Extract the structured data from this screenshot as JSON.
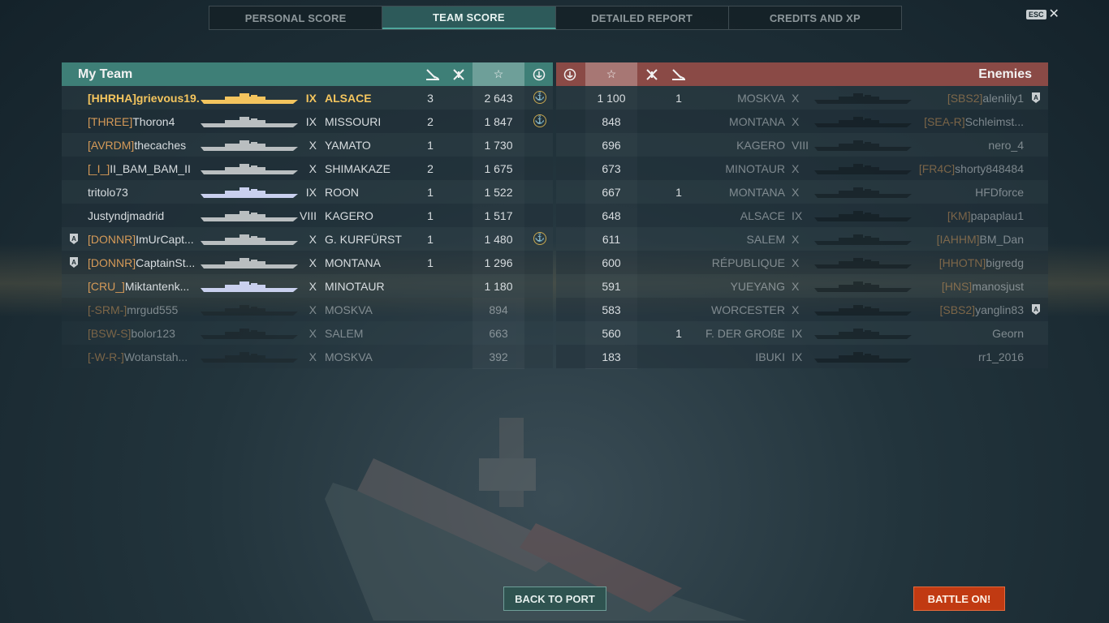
{
  "tabs": [
    {
      "label": "PERSONAL SCORE"
    },
    {
      "label": "TEAM SCORE"
    },
    {
      "label": "DETAILED REPORT"
    },
    {
      "label": "CREDITS AND XP"
    }
  ],
  "active_tab": "TEAM SCORE",
  "esc_label": "ESC",
  "close_glyph": "✕",
  "my_team": {
    "title": "My Team",
    "rows": [
      {
        "clan": "[HHRHA]",
        "name": "grievous19...",
        "tier": "IX",
        "ship": "ALSACE",
        "kills": "3",
        "xp": "2 643",
        "anchor": true,
        "badge": false
      },
      {
        "clan": "[THREE]",
        "name": "Thoron4",
        "tier": "IX",
        "ship": "MISSOURI",
        "kills": "2",
        "xp": "1 847",
        "anchor": true,
        "badge": false
      },
      {
        "clan": "[AVRDM]",
        "name": "thecaches",
        "tier": "X",
        "ship": "YAMATO",
        "kills": "1",
        "xp": "1 730",
        "anchor": false,
        "badge": false
      },
      {
        "clan": "[_I_]",
        "name": "II_BAM_BAM_II",
        "tier": "X",
        "ship": "SHIMAKAZE",
        "kills": "2",
        "xp": "1 675",
        "anchor": false,
        "badge": false
      },
      {
        "clan": "",
        "name": "tritolo73",
        "tier": "IX",
        "ship": "ROON",
        "kills": "1",
        "xp": "1 522",
        "anchor": false,
        "badge": false
      },
      {
        "clan": "",
        "name": "Justyndjmadrid",
        "tier": "VIII",
        "ship": "KAGERO",
        "kills": "1",
        "xp": "1 517",
        "anchor": false,
        "badge": false
      },
      {
        "clan": "[DONNR]",
        "name": "ImUrCapt...",
        "tier": "X",
        "ship": "G. KURFÜRST",
        "kills": "1",
        "xp": "1 480",
        "anchor": true,
        "badge": true
      },
      {
        "clan": "[DONNR]",
        "name": "CaptainSt...",
        "tier": "X",
        "ship": "MONTANA",
        "kills": "1",
        "xp": "1 296",
        "anchor": false,
        "badge": true
      },
      {
        "clan": "[CRU_]",
        "name": "Miktantenk...",
        "tier": "X",
        "ship": "MINOTAUR",
        "kills": "",
        "xp": "1 180",
        "anchor": false,
        "badge": false
      },
      {
        "clan": "[-SRM-]",
        "name": "mrgud555",
        "tier": "X",
        "ship": "MOSKVA",
        "kills": "",
        "xp": "894",
        "anchor": false,
        "badge": false
      },
      {
        "clan": "[BSW-S]",
        "name": "bolor123",
        "tier": "X",
        "ship": "SALEM",
        "kills": "",
        "xp": "663",
        "anchor": false,
        "badge": false
      },
      {
        "clan": "[-W-R-]",
        "name": "Wotanstah...",
        "tier": "X",
        "ship": "MOSKVA",
        "kills": "",
        "xp": "392",
        "anchor": false,
        "badge": false
      }
    ]
  },
  "enemies": {
    "title": "Enemies",
    "rows": [
      {
        "xp": "1 100",
        "kills": "1",
        "ship": "MOSKVA",
        "tier": "X",
        "clan": "[SBS2]",
        "name": "alenlily1",
        "badge": true
      },
      {
        "xp": "848",
        "kills": "",
        "ship": "MONTANA",
        "tier": "X",
        "clan": "[SEA-R]",
        "name": "Schleimst...",
        "badge": false
      },
      {
        "xp": "696",
        "kills": "",
        "ship": "KAGERO",
        "tier": "VIII",
        "clan": "",
        "name": "nero_4",
        "badge": false
      },
      {
        "xp": "673",
        "kills": "",
        "ship": "MINOTAUR",
        "tier": "X",
        "clan": "[FR4C]",
        "name": "shorty848484",
        "badge": false
      },
      {
        "xp": "667",
        "kills": "1",
        "ship": "MONTANA",
        "tier": "X",
        "clan": "",
        "name": "HFDforce",
        "badge": false
      },
      {
        "xp": "648",
        "kills": "",
        "ship": "ALSACE",
        "tier": "IX",
        "clan": "[KM]",
        "name": "papaplau1",
        "badge": false
      },
      {
        "xp": "611",
        "kills": "",
        "ship": "SALEM",
        "tier": "X",
        "clan": "[IAHHM]",
        "name": "BM_Dan",
        "badge": false
      },
      {
        "xp": "600",
        "kills": "",
        "ship": "RÉPUBLIQUE",
        "tier": "X",
        "clan": "[HHOTN]",
        "name": "bigredg",
        "badge": false
      },
      {
        "xp": "591",
        "kills": "",
        "ship": "YUEYANG",
        "tier": "X",
        "clan": "[HNS]",
        "name": "manosjust",
        "badge": false
      },
      {
        "xp": "583",
        "kills": "",
        "ship": "WORCESTER",
        "tier": "X",
        "clan": "[SBS2]",
        "name": "yanglin83",
        "badge": true
      },
      {
        "xp": "560",
        "kills": "1",
        "ship": "F. DER GROßE",
        "tier": "IX",
        "clan": "",
        "name": "Georn",
        "badge": false
      },
      {
        "xp": "183",
        "kills": "",
        "ship": "IBUKI",
        "tier": "IX",
        "clan": "",
        "name": "rr1_2016",
        "badge": false
      }
    ]
  },
  "buttons": {
    "back": "BACK TO PORT",
    "battle": "BATTLE ON!"
  },
  "colors": {
    "team_header": "#3e7f77",
    "enemy_header": "#8a4a46",
    "clan": "#d59a58",
    "me": "#f4c55e",
    "battle_button": "#c13a12"
  }
}
